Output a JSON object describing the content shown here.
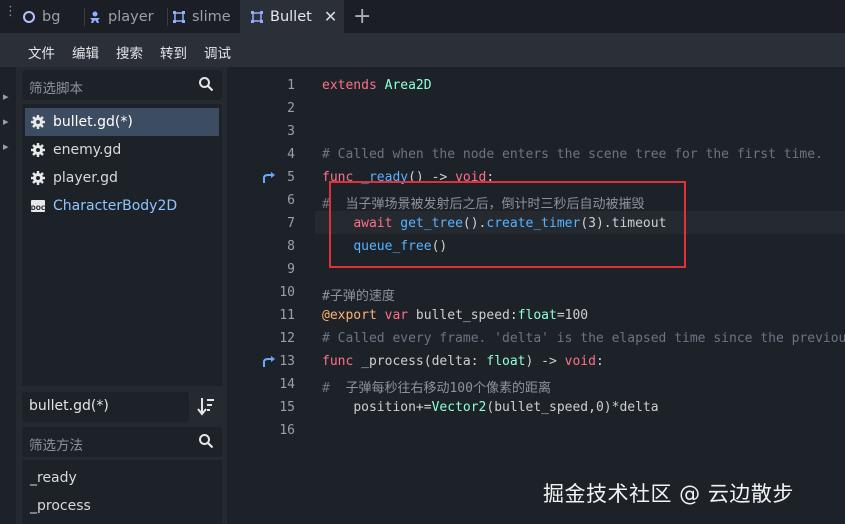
{
  "tabs": [
    {
      "label": "bg",
      "icon": "circle-node-icon",
      "active": false
    },
    {
      "label": "player",
      "icon": "character-node-icon",
      "active": false
    },
    {
      "label": "slime",
      "icon": "node2d-icon",
      "active": false
    },
    {
      "label": "Bullet",
      "icon": "node2d-icon",
      "active": true
    }
  ],
  "menu": [
    "文件",
    "编辑",
    "搜索",
    "转到",
    "调试"
  ],
  "scripts_panel": {
    "filter_placeholder": "筛选脚本",
    "items": [
      {
        "label": "bullet.gd(*)",
        "icon": "gear-icon",
        "selected": true
      },
      {
        "label": "enemy.gd",
        "icon": "gear-icon",
        "selected": false
      },
      {
        "label": "player.gd",
        "icon": "gear-icon",
        "selected": false
      },
      {
        "label": "CharacterBody2D",
        "icon": "doc-icon",
        "selected": false
      }
    ],
    "current_script": "bullet.gd(*)",
    "method_filter_placeholder": "筛选方法",
    "methods": [
      "_ready",
      "_process"
    ]
  },
  "editor": {
    "line_numbers": [
      "1",
      "2",
      "3",
      "4",
      "5",
      "6",
      "7",
      "8",
      "9",
      "10",
      "11",
      "12",
      "13",
      "14",
      "15",
      "16"
    ],
    "lines": {
      "l1_kw": "extends",
      "l1_type": "Area2D",
      "l4": "# Called when the node enters the scene tree for the first time.",
      "l5_kw": "func",
      "l5_name": " _ready",
      "l5_rest": "() -> ",
      "l5_ret": "void",
      "l5_colon": ":",
      "l6_hash": "#",
      "l6_text": "当子弹场景被发射后之后，倒计时三秒后自动被摧毁",
      "l7_kw": "await",
      "l7_f1": "get_tree",
      "l7_p1": "().",
      "l7_f2": "create_timer",
      "l7_rest": "(3).timeout",
      "l8_f": "queue_free",
      "l8_rest": "()",
      "l10": "#子弹的速度",
      "l11_an": "@export",
      "l11_kw": "var",
      "l11_name": " bullet_speed:",
      "l11_type": "float",
      "l11_rest": "=100",
      "l12": "# Called every frame. 'delta' is the elapsed time since the previous frame.",
      "l13_kw": "func",
      "l13_name": " _process(delta: ",
      "l13_type": "float",
      "l13_rest": ") -> ",
      "l13_ret": "void",
      "l13_colon": ":",
      "l14_hash": "#",
      "l14_text": "子弹每秒往右移动100个像素的距离",
      "l15_pre": "position+=",
      "l15_type": "Vector2",
      "l15_rest": "(bullet_speed,0)*delta"
    }
  },
  "watermark": "掘金技术社区 @ 云边散步",
  "colors": {
    "keyword": "#ff7085",
    "type": "#8effda",
    "function": "#57b3ff",
    "comment": "#6b7480",
    "annotation": "#ffb373",
    "highlight_box": "#e0303a"
  }
}
